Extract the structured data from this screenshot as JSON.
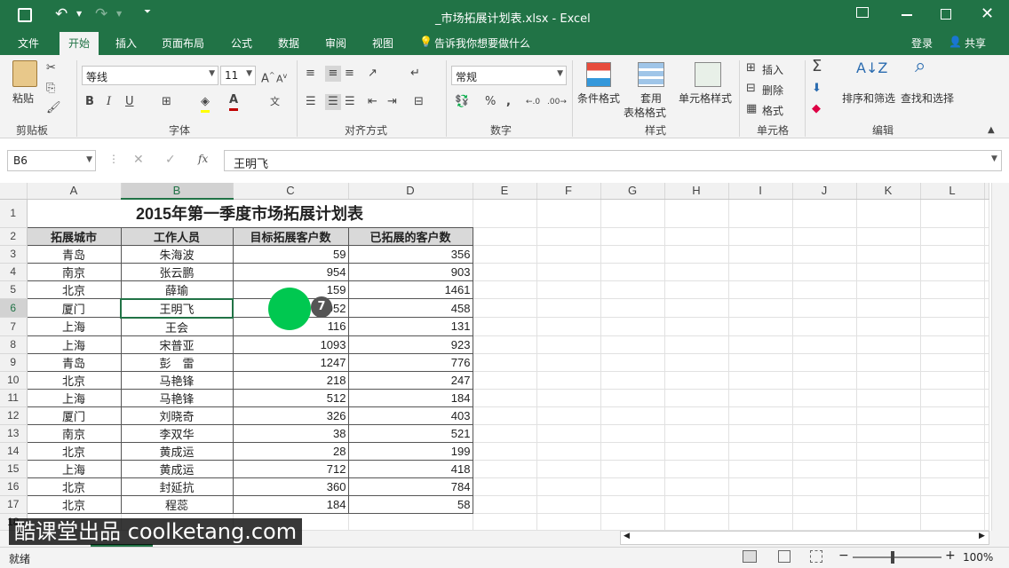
{
  "window": {
    "title": "_市场拓展计划表.xlsx - Excel"
  },
  "menu": {
    "tabs": [
      "文件",
      "开始",
      "插入",
      "页面布局",
      "公式",
      "数据",
      "审阅",
      "视图"
    ],
    "tell_me": "告诉我你想要做什么",
    "login": "登录",
    "share": "共享"
  },
  "ribbon": {
    "paste_label": "粘贴",
    "clipboard_group": "剪贴板",
    "font_name": "等线",
    "font_size": "11",
    "font_group": "字体",
    "bold": "B",
    "italic": "I",
    "underline": "U",
    "align_group": "对齐方式",
    "number_format": "常规",
    "percent": "%",
    "comma": ",",
    "number_group": "数字",
    "conditional_format": "条件格式",
    "table_format_1": "套用",
    "table_format_2": "表格格式",
    "cell_style": "单元格样式",
    "styles_group": "样式",
    "insert": "插入",
    "delete": "删除",
    "format": "格式",
    "cells_group": "单元格",
    "sort_filter": "排序和筛选",
    "find_select": "查找和选择",
    "edit_group": "编辑"
  },
  "formula_bar": {
    "name_box": "B6",
    "fx": "fx",
    "content": "王明飞"
  },
  "sheet": {
    "columns": [
      "A",
      "B",
      "C",
      "D",
      "E",
      "F",
      "G",
      "H",
      "I",
      "J",
      "K",
      "L"
    ],
    "selected_col": "B",
    "selected_row": 6,
    "title": "2015年第一季度市场拓展计划表",
    "headers": [
      "拓展城市",
      "工作人员",
      "目标拓展客户数",
      "已拓展的客户数"
    ],
    "rows": [
      {
        "r": 3,
        "city": "青岛",
        "person": "朱海波",
        "target": "59",
        "done": "356"
      },
      {
        "r": 4,
        "city": "南京",
        "person": "张云鹏",
        "target": "954",
        "done": "903"
      },
      {
        "r": 5,
        "city": "北京",
        "person": "薛瑜",
        "target": "159",
        "done": "1461"
      },
      {
        "r": 6,
        "city": "厦门",
        "person": "王明飞",
        "target": "952",
        "done": "458"
      },
      {
        "r": 7,
        "city": "上海",
        "person": "王会",
        "target": "116",
        "done": "131"
      },
      {
        "r": 8,
        "city": "上海",
        "person": "宋普亚",
        "target": "1093",
        "done": "923"
      },
      {
        "r": 9,
        "city": "青岛",
        "person": "彭　雷",
        "target": "1247",
        "done": "776"
      },
      {
        "r": 10,
        "city": "北京",
        "person": "马艳锋",
        "target": "218",
        "done": "247"
      },
      {
        "r": 11,
        "city": "上海",
        "person": "马艳锋",
        "target": "512",
        "done": "184"
      },
      {
        "r": 12,
        "city": "厦门",
        "person": "刘晓奇",
        "target": "326",
        "done": "403"
      },
      {
        "r": 13,
        "city": "南京",
        "person": "李双华",
        "target": "38",
        "done": "521"
      },
      {
        "r": 14,
        "city": "北京",
        "person": "黄成运",
        "target": "28",
        "done": "199"
      },
      {
        "r": 15,
        "city": "上海",
        "person": "黄成运",
        "target": "712",
        "done": "418"
      },
      {
        "r": 16,
        "city": "北京",
        "person": "封延抗",
        "target": "360",
        "done": "784"
      },
      {
        "r": 17,
        "city": "北京",
        "person": "程蕊",
        "target": "184",
        "done": "58"
      }
    ],
    "extra_row": 18
  },
  "click_marker": {
    "number": "7",
    "color": "#00c850"
  },
  "status": {
    "ready": "就绪",
    "zoom": "100%"
  },
  "watermark": "酷课堂出品 coolketang.com",
  "colors": {
    "accent": "#217346"
  }
}
